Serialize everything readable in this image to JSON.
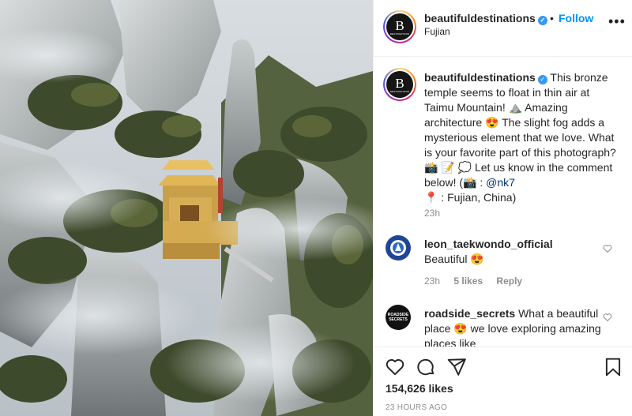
{
  "post": {
    "username": "beautifuldestinations",
    "location": "Fujian",
    "follow_label": "Follow",
    "separator": "•",
    "more_label": "•••",
    "avatar_letter": "B",
    "avatar_wordmark": "DESTINATIONS",
    "verified_mark": "✓"
  },
  "caption": {
    "username": "beautifuldestinations",
    "text_1": " This bronze temple seems to float in thin air at Taimu Mountain! ⛰️  Amazing architecture 😍  The slight fog adds a mysterious element that we love. What is your favorite part of this photograph? 📸 📝 💭  Let us know in the comment below! (📸 : ",
    "mention": "@nk7",
    "text_2": "📍 : Fujian, China)",
    "time": "23h"
  },
  "comments": [
    {
      "username": "leon_taekwondo_official",
      "text": "Beautiful 😍",
      "time": "23h",
      "likes": "5 likes",
      "reply": "Reply"
    },
    {
      "username": "roadside_secrets",
      "text": " What a beautiful place 😍  we love exploring amazing places like",
      "avatar_text": "ROADSIDE SECRETS"
    }
  ],
  "footer": {
    "likes": "154,626 likes",
    "time_ago": "23 HOURS AGO"
  },
  "icons": {
    "like": "heart-icon",
    "comment": "comment-icon",
    "share": "share-icon",
    "save": "bookmark-icon",
    "more": "more-icon"
  },
  "colors": {
    "link": "#0095f6",
    "verified": "#3897f0",
    "muted": "#8e8e8e",
    "text": "#262626"
  }
}
